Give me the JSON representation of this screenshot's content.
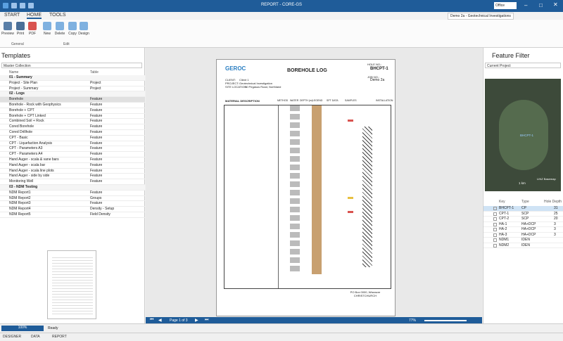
{
  "window": {
    "title": "REPORT - CORE-GS",
    "theme": "Office",
    "project_badge": "Demo 2a - Geotechnical Investigations"
  },
  "ribbon": {
    "tabs": [
      "START",
      "HOME",
      "TOOLS"
    ],
    "buttons": [
      "Preview",
      "Print",
      "PDF",
      "New",
      "Delete",
      "Copy",
      "Design"
    ],
    "groups": [
      "General",
      "Edit"
    ]
  },
  "templates": {
    "title": "Templates",
    "collection": "Master Collection",
    "col_name": "Name",
    "col_table": "Table",
    "rows": [
      {
        "n": "01 - Summary",
        "t": "",
        "g": true
      },
      {
        "n": "Project - Site Plan",
        "t": "Project"
      },
      {
        "n": "Project - Summary",
        "t": "Project"
      },
      {
        "n": "02 - Logs",
        "t": "",
        "g": true
      },
      {
        "n": "Borehole",
        "t": "Feature",
        "s": true
      },
      {
        "n": "Borehole - Rock with Geophysics",
        "t": "Feature"
      },
      {
        "n": "Borehole + CPT",
        "t": "Feature"
      },
      {
        "n": "Borehole + CPT Linked",
        "t": "Feature"
      },
      {
        "n": "Combined Soil + Rock",
        "t": "Feature"
      },
      {
        "n": "Cored Borehole",
        "t": "Feature"
      },
      {
        "n": "Cored Drillhole",
        "t": "Feature"
      },
      {
        "n": "CPT - Basic",
        "t": "Feature"
      },
      {
        "n": "CPT - Liquefaction Analysis",
        "t": "Feature"
      },
      {
        "n": "CPT - Parameters A3",
        "t": "Feature"
      },
      {
        "n": "CPT - Parameters A4",
        "t": "Feature"
      },
      {
        "n": "Hand Auger - scala & vane bars",
        "t": "Feature"
      },
      {
        "n": "Hand Auger - scala bar",
        "t": "Feature"
      },
      {
        "n": "Hand Auger - scala line plots",
        "t": "Feature"
      },
      {
        "n": "Hand Auger - side by side",
        "t": "Feature"
      },
      {
        "n": "Monitoring Well",
        "t": "Feature"
      },
      {
        "n": "03 - NDM Testing",
        "t": "",
        "g": true
      },
      {
        "n": "NDM Report1",
        "t": "Feature"
      },
      {
        "n": "NDM Report2",
        "t": "Groups"
      },
      {
        "n": "NDM Report3",
        "t": "Feature"
      },
      {
        "n": "NDM Report4",
        "t": "Density - Setup"
      },
      {
        "n": "NDM Report5",
        "t": "Field Density"
      }
    ]
  },
  "report": {
    "heading": "BOREHOLE LOG",
    "hole_no_label": "HOLE NO.:",
    "hole_no": "BHCPT-1",
    "job_no_label": "JOB NO.:",
    "job_no": "Demo 2a",
    "logo": "GEROC",
    "client_label": "CLIENT:",
    "client": "Client 1",
    "project_label": "PROJECT:",
    "project": "Geotechnical Investigation",
    "site_label": "SITE LOCATION:",
    "site": "10 Pegasus Road, Northland",
    "col_material": "MATERIAL DESCRIPTION",
    "col_method": "METHOD",
    "col_water": "WATER",
    "col_depth": "DEPTH (m)",
    "col_legend": "LEGEND",
    "col_samples": "SAMPLES",
    "col_spt": "SPT DATA",
    "col_install": "INSTALLATION",
    "footer": "PO Box 0000, Wiseacre CHRISTCHURCH"
  },
  "navbar": {
    "page": "Page 1 of 3",
    "zoom": "77%"
  },
  "feature_filter": {
    "title": "Feature Filter",
    "dataset": "Current Project",
    "map_scale": "1 km",
    "map_label": "LINZ Basemap",
    "map_pin": "BHCPT-1",
    "cols": [
      "Key",
      "Type",
      "Hole Depth"
    ],
    "rows": [
      {
        "k": "BHCPT-1",
        "t": "CP",
        "d": "31",
        "s": true
      },
      {
        "k": "CPT-1",
        "t": "SCP",
        "d": "25"
      },
      {
        "k": "CPT-2",
        "t": "SCP",
        "d": "20"
      },
      {
        "k": "HA-1",
        "t": "HA+DCP",
        "d": "3"
      },
      {
        "k": "HA-2",
        "t": "HA+DCP",
        "d": "3"
      },
      {
        "k": "HA-3",
        "t": "HA+DCP",
        "d": "3"
      },
      {
        "k": "NDM1",
        "t": "IDEN",
        "d": ""
      },
      {
        "k": "NDM2",
        "t": "IDEN",
        "d": ""
      }
    ]
  },
  "status": {
    "progress": "100%",
    "text": "Ready"
  },
  "bottom_tabs": [
    "DESIGNER",
    "DATA",
    "REPORT"
  ]
}
